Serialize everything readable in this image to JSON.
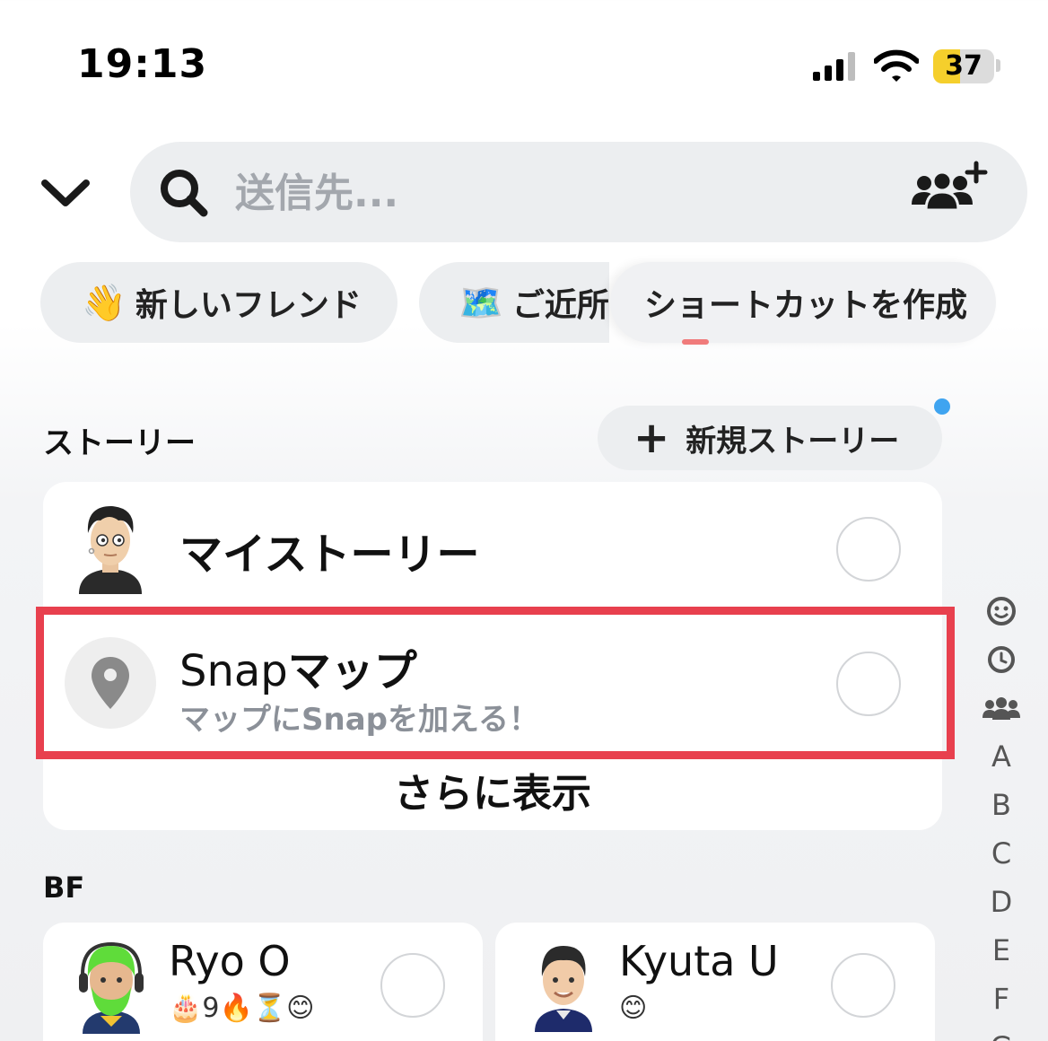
{
  "status_bar": {
    "time": "19:13",
    "battery": "37"
  },
  "search": {
    "placeholder": "送信先..."
  },
  "chips": [
    {
      "emoji": "👋",
      "label": "新しいフレンド"
    },
    {
      "emoji": "🗺️",
      "label": "ご近所"
    },
    {
      "label": "ショートカットを作成"
    }
  ],
  "stories": {
    "title": "ストーリー",
    "new_story_label": "新規ストーリー",
    "my_story": {
      "title": "マイストーリー"
    },
    "snap_map": {
      "title_latin": "Snap",
      "title_jp": "マップ",
      "subtitle": "マップにSnapを加える！"
    },
    "show_more": "さらに表示"
  },
  "bf": {
    "title": "BF",
    "friends": [
      {
        "name": "Ryo O",
        "emoji": "🎂9🔥⏳😊"
      },
      {
        "name": "Kyuta U",
        "emoji": "😊"
      }
    ]
  },
  "side_index": [
    "smiley-icon",
    "clock-icon",
    "group-icon",
    "A",
    "B",
    "C",
    "D",
    "E",
    "F",
    "G"
  ],
  "colors": {
    "highlight": "#e8404e",
    "chip_bg": "#eceef0",
    "notification_dot": "#3fa4f0",
    "battery": "#f5cf2c"
  }
}
